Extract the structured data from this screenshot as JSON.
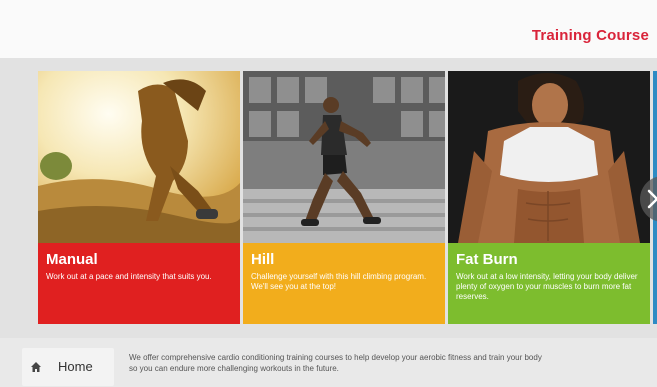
{
  "header": {
    "title": "Training Course"
  },
  "cards": [
    {
      "title": "Manual",
      "description": "Work out at a pace and intensity that suits you.",
      "color": "#e02020"
    },
    {
      "title": "Hill",
      "description": "Challenge yourself with this hill climbing program. We'll see you at the top!",
      "color": "#f2ad1c"
    },
    {
      "title": "Fat Burn",
      "description": "Work out at a low intensity, letting your body deliver plenty of oxygen to your muscles to burn more fat reserves.",
      "color": "#7dbd2e"
    }
  ],
  "footer": {
    "home_label": "Home",
    "home_icon": "home-icon",
    "description": "We offer comprehensive cardio conditioning training courses to help develop your aerobic fitness and train your body so you can endure more challenging workouts in the future."
  },
  "nav": {
    "next_icon": "chevron-right-icon"
  }
}
